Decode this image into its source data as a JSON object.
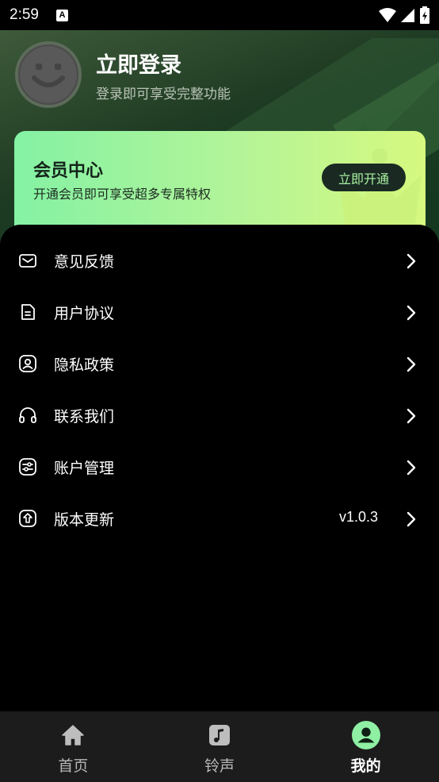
{
  "status_bar": {
    "time": "2:59",
    "notification_letter": "A"
  },
  "header": {
    "login_title": "立即登录",
    "login_subtitle": "登录即可享受完整功能"
  },
  "vip_card": {
    "title": "会员中心",
    "subtitle": "开通会员即可享受超多专属特权",
    "button_label": "立即开通"
  },
  "menu": [
    {
      "label": "意见反馈",
      "icon": "mail-icon"
    },
    {
      "label": "用户协议",
      "icon": "document-icon"
    },
    {
      "label": "隐私政策",
      "icon": "privacy-user-icon"
    },
    {
      "label": "联系我们",
      "icon": "headphones-icon"
    },
    {
      "label": "账户管理",
      "icon": "account-settings-icon"
    },
    {
      "label": "版本更新",
      "icon": "update-icon",
      "value": "v1.0.3"
    }
  ],
  "tabs": [
    {
      "label": "首页",
      "icon": "home-icon",
      "active": false
    },
    {
      "label": "铃声",
      "icon": "music-note-icon",
      "active": false
    },
    {
      "label": "我的",
      "icon": "profile-icon",
      "active": true
    }
  ],
  "colors": {
    "accent": "#8ff0a4",
    "vip_gradient_start": "#84f2a4",
    "vip_gradient_end": "#d6f97f",
    "sheet_background": "#000000",
    "tabbar_background": "#1c1c1c"
  }
}
